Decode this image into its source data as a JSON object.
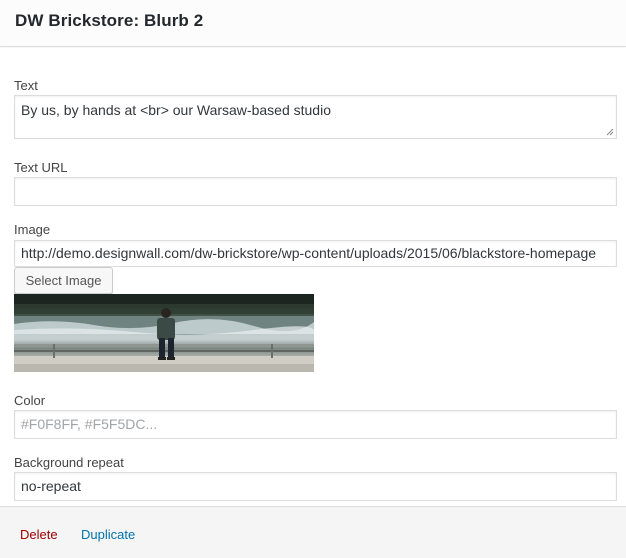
{
  "widget": {
    "title": "DW Brickstore: Blurb 2"
  },
  "fields": {
    "text": {
      "label": "Text",
      "value": "By us, by hands at <br> our Warsaw-based studio"
    },
    "text_url": {
      "label": "Text URL",
      "value": ""
    },
    "image": {
      "label": "Image",
      "value": "http://demo.designwall.com/dw-brickstore/wp-content/uploads/2015/06/blackstore-homepage",
      "select_button": "Select Image",
      "preview_alt": "man sitting on railing by river"
    },
    "color": {
      "label": "Color",
      "placeholder": "#F0F8FF, #F5F5DC..."
    },
    "background_repeat": {
      "label": "Background repeat",
      "value": "no-repeat"
    }
  },
  "actions": {
    "delete": "Delete",
    "duplicate": "Duplicate"
  },
  "colors": {
    "delete_link": "#a00000",
    "duplicate_link": "#0073aa",
    "border": "#dddddd"
  }
}
